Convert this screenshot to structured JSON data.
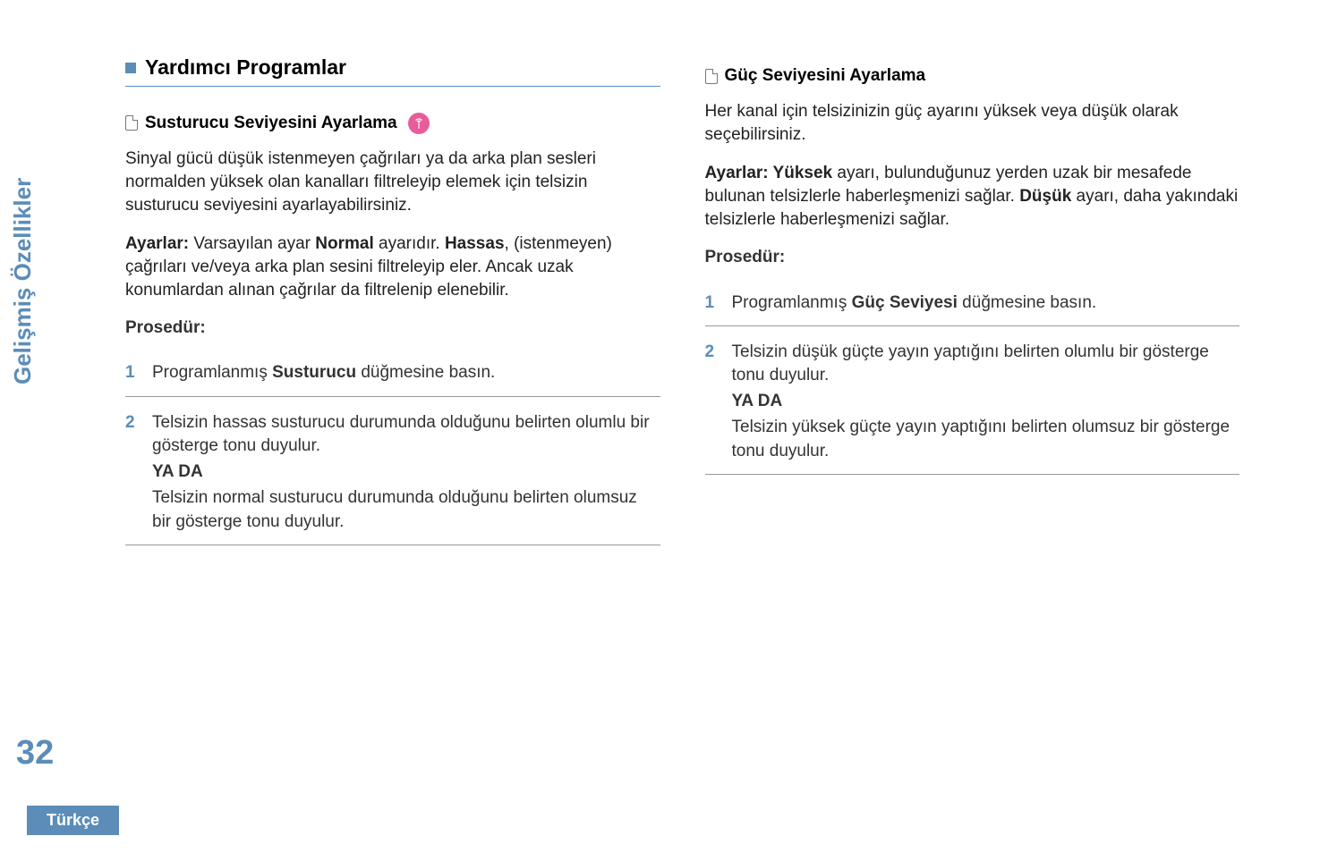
{
  "side_label": "Gelişmiş Özellikler",
  "page_number": "32",
  "lang_tab": "Türkçe",
  "left": {
    "h1": "Yardımcı Programlar",
    "h2": "Susturucu Seviyesini Ayarlama",
    "p1": "Sinyal gücü düşük istenmeyen çağrıları ya da arka plan sesleri normalden yüksek olan kanalları filtreleyip elemek için telsizin susturucu seviyesini ayarlayabilirsiniz.",
    "p2_lead": "Ayarlar:",
    "p2_rest": " Varsayılan ayar ",
    "p2_b1": "Normal",
    "p2_mid": " ayarıdır. ",
    "p2_b2": "Hassas",
    "p2_tail": ", (istenmeyen) çağrıları ve/veya arka plan sesini filtreleyip eler. Ancak uzak konumlardan alınan çağrılar da filtrelenip elenebilir.",
    "proc": "Prosedür:",
    "s1_a": "Programlanmış ",
    "s1_b": "Susturucu",
    "s1_c": " düğmesine basın.",
    "s2_a": "Telsizin hassas susturucu durumunda olduğunu belirten olumlu bir gösterge tonu duyulur.",
    "s2_or": "YA DA",
    "s2_b": "Telsizin normal susturucu durumunda olduğunu belirten olumsuz bir gösterge tonu duyulur."
  },
  "right": {
    "h2": "Güç Seviyesini Ayarlama",
    "p1": "Her kanal için telsizinizin güç ayarını yüksek veya düşük olarak seçebilirsiniz.",
    "p2_lead": "Ayarlar:  ",
    "p2_b1": "Yüksek",
    "p2_mid": " ayarı, bulunduğunuz yerden uzak bir mesafede bulunan telsizlerle haberleşmenizi sağlar. ",
    "p2_b2": "Düşük",
    "p2_tail": " ayarı, daha yakındaki telsizlerle haberleşmenizi sağlar.",
    "proc": "Prosedür:",
    "s1_a": "Programlanmış ",
    "s1_b": "Güç Seviyesi",
    "s1_c": " düğmesine basın.",
    "s2_a": "Telsizin düşük güçte yayın yaptığını belirten olumlu bir gösterge tonu duyulur.",
    "s2_or": "YA DA",
    "s2_b": "Telsizin yüksek güçte yayın yaptığını belirten olumsuz bir gösterge tonu duyulur."
  }
}
